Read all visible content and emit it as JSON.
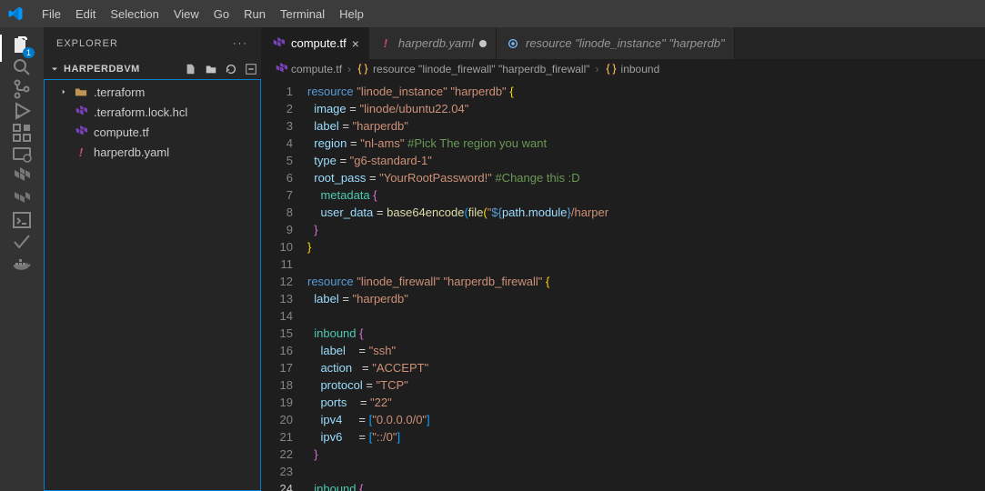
{
  "menu": {
    "items": [
      "File",
      "Edit",
      "Selection",
      "View",
      "Go",
      "Run",
      "Terminal",
      "Help"
    ]
  },
  "activity": {
    "icons": [
      "files-icon",
      "search-icon",
      "source-control-icon",
      "run-debug-icon",
      "extensions-icon",
      "remote-explorer-icon",
      "terraform-icon",
      "terraform-alt-icon",
      "console-icon",
      "check-icon",
      "docker-icon"
    ],
    "active": 0,
    "badge": "1"
  },
  "sidebar": {
    "title": "EXPLORER",
    "folder": "HARPERDBVM",
    "header_actions": [
      "new-file-icon",
      "new-folder-icon",
      "refresh-icon",
      "collapse-icon"
    ],
    "tree": [
      {
        "kind": "folder",
        "name": ".terraform",
        "icon": "chevron-right-icon"
      },
      {
        "kind": "file",
        "name": ".terraform.lock.hcl",
        "icon": "terraform-file-icon",
        "color": "#7b42bc"
      },
      {
        "kind": "file",
        "name": "compute.tf",
        "icon": "terraform-file-icon",
        "color": "#7b42bc"
      },
      {
        "kind": "file",
        "name": "harperdb.yaml",
        "icon": "yaml-file-icon",
        "color": "#cb4b7a"
      }
    ]
  },
  "tabs": [
    {
      "label": "compute.tf",
      "icon": "terraform-file-icon",
      "color": "#7b42bc",
      "active": true,
      "close": "×"
    },
    {
      "label": "harperdb.yaml",
      "icon": "yaml-file-icon",
      "color": "#cb4b7a",
      "active": false,
      "modified": true,
      "italic": true
    },
    {
      "label": "resource \"linode_instance\" \"harperdb\"",
      "icon": "symbol-icon",
      "color": "#75beff",
      "active": false,
      "italic": true
    }
  ],
  "breadcrumbs": [
    {
      "icon": "terraform-file-icon",
      "color": "#7b42bc",
      "label": "compute.tf"
    },
    {
      "icon": "symbol-namespace-icon",
      "color": "#e8ab53",
      "label": "resource \"linode_firewall\" \"harperdb_firewall\""
    },
    {
      "icon": "symbol-namespace-icon",
      "color": "#e8ab53",
      "label": "inbound"
    }
  ],
  "code": {
    "start": 1,
    "active": 24,
    "lines": [
      [
        [
          "kw",
          "resource"
        ],
        [
          "punc",
          " "
        ],
        [
          "str",
          "\"linode_instance\""
        ],
        [
          "punc",
          " "
        ],
        [
          "str",
          "\"harperdb\""
        ],
        [
          "punc",
          " "
        ],
        [
          "brace-y",
          "{"
        ]
      ],
      [
        [
          "punc",
          "  "
        ],
        [
          "prop",
          "image"
        ],
        [
          "punc",
          " "
        ],
        [
          "op",
          "="
        ],
        [
          "punc",
          " "
        ],
        [
          "str",
          "\"linode/ubuntu22.04\""
        ]
      ],
      [
        [
          "punc",
          "  "
        ],
        [
          "prop",
          "label"
        ],
        [
          "punc",
          " "
        ],
        [
          "op",
          "="
        ],
        [
          "punc",
          " "
        ],
        [
          "str",
          "\"harperdb\""
        ]
      ],
      [
        [
          "punc",
          "  "
        ],
        [
          "prop",
          "region"
        ],
        [
          "punc",
          " "
        ],
        [
          "op",
          "="
        ],
        [
          "punc",
          " "
        ],
        [
          "str",
          "\"nl-ams\""
        ],
        [
          "punc",
          " "
        ],
        [
          "cmt",
          "#Pick The region you want"
        ]
      ],
      [
        [
          "punc",
          "  "
        ],
        [
          "prop",
          "type"
        ],
        [
          "punc",
          " "
        ],
        [
          "op",
          "="
        ],
        [
          "punc",
          " "
        ],
        [
          "str",
          "\"g6-standard-1\""
        ]
      ],
      [
        [
          "punc",
          "  "
        ],
        [
          "prop",
          "root_pass"
        ],
        [
          "punc",
          " "
        ],
        [
          "op",
          "="
        ],
        [
          "punc",
          " "
        ],
        [
          "str",
          "\"YourRootPassword!\""
        ],
        [
          "punc",
          " "
        ],
        [
          "cmt",
          "#Change this :D"
        ]
      ],
      [
        [
          "punc",
          "    "
        ],
        [
          "type",
          "metadata"
        ],
        [
          "punc",
          " "
        ],
        [
          "brace-p",
          "{"
        ]
      ],
      [
        [
          "punc",
          "    "
        ],
        [
          "prop",
          "user_data"
        ],
        [
          "punc",
          " "
        ],
        [
          "op",
          "="
        ],
        [
          "punc",
          " "
        ],
        [
          "fn",
          "base64encode"
        ],
        [
          "brace-b",
          "("
        ],
        [
          "fn",
          "file"
        ],
        [
          "brace-y",
          "("
        ],
        [
          "str",
          "\""
        ],
        [
          "kw",
          "${"
        ],
        [
          "prop",
          "path"
        ],
        [
          "punc",
          "."
        ],
        [
          "prop",
          "module"
        ],
        [
          "kw",
          "}"
        ],
        [
          "str",
          "/harper"
        ]
      ],
      [
        [
          "punc",
          "  "
        ],
        [
          "brace-p",
          "}"
        ]
      ],
      [
        [
          "brace-y",
          "}"
        ]
      ],
      [],
      [
        [
          "kw",
          "resource"
        ],
        [
          "punc",
          " "
        ],
        [
          "str",
          "\"linode_firewall\""
        ],
        [
          "punc",
          " "
        ],
        [
          "str",
          "\"harperdb_firewall\""
        ],
        [
          "punc",
          " "
        ],
        [
          "brace-y",
          "{"
        ]
      ],
      [
        [
          "punc",
          "  "
        ],
        [
          "prop",
          "label"
        ],
        [
          "punc",
          " "
        ],
        [
          "op",
          "="
        ],
        [
          "punc",
          " "
        ],
        [
          "str",
          "\"harperdb\""
        ]
      ],
      [],
      [
        [
          "punc",
          "  "
        ],
        [
          "type",
          "inbound"
        ],
        [
          "punc",
          " "
        ],
        [
          "brace-p",
          "{"
        ]
      ],
      [
        [
          "punc",
          "    "
        ],
        [
          "prop",
          "label"
        ],
        [
          "punc",
          "    "
        ],
        [
          "op",
          "="
        ],
        [
          "punc",
          " "
        ],
        [
          "str",
          "\"ssh\""
        ]
      ],
      [
        [
          "punc",
          "    "
        ],
        [
          "prop",
          "action"
        ],
        [
          "punc",
          "   "
        ],
        [
          "op",
          "="
        ],
        [
          "punc",
          " "
        ],
        [
          "str",
          "\"ACCEPT\""
        ]
      ],
      [
        [
          "punc",
          "    "
        ],
        [
          "prop",
          "protocol"
        ],
        [
          "punc",
          " "
        ],
        [
          "op",
          "="
        ],
        [
          "punc",
          " "
        ],
        [
          "str",
          "\"TCP\""
        ]
      ],
      [
        [
          "punc",
          "    "
        ],
        [
          "prop",
          "ports"
        ],
        [
          "punc",
          "    "
        ],
        [
          "op",
          "="
        ],
        [
          "punc",
          " "
        ],
        [
          "str",
          "\"22\""
        ]
      ],
      [
        [
          "punc",
          "    "
        ],
        [
          "prop",
          "ipv4"
        ],
        [
          "punc",
          "     "
        ],
        [
          "op",
          "="
        ],
        [
          "punc",
          " "
        ],
        [
          "brace-b",
          "["
        ],
        [
          "str",
          "\"0.0.0.0/0\""
        ],
        [
          "brace-b",
          "]"
        ]
      ],
      [
        [
          "punc",
          "    "
        ],
        [
          "prop",
          "ipv6"
        ],
        [
          "punc",
          "     "
        ],
        [
          "op",
          "="
        ],
        [
          "punc",
          " "
        ],
        [
          "brace-b",
          "["
        ],
        [
          "str",
          "\"::/0\""
        ],
        [
          "brace-b",
          "]"
        ]
      ],
      [
        [
          "punc",
          "  "
        ],
        [
          "brace-p",
          "}"
        ]
      ],
      [],
      [
        [
          "punc",
          "  "
        ],
        [
          "type",
          "inbound"
        ],
        [
          "punc",
          " "
        ],
        [
          "brace-p",
          "{"
        ]
      ]
    ]
  }
}
